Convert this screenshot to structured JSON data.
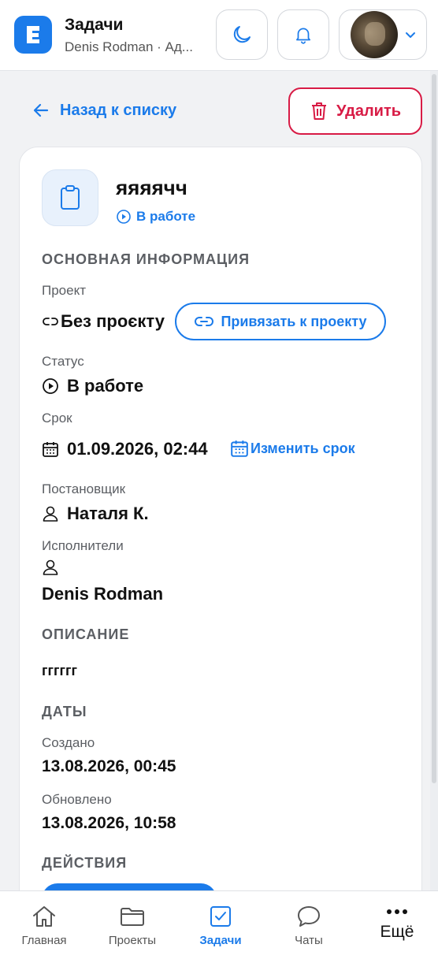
{
  "header": {
    "app_title": "Задачи",
    "app_subtitle": "Denis Rodman · Ад...",
    "logo_letter": "E"
  },
  "top_actions": {
    "back_label": "Назад к списку",
    "delete_label": "Удалить"
  },
  "task": {
    "title": "яяяячч",
    "status_badge": "В работе"
  },
  "sections": {
    "main_info": "ОСНОВНАЯ ИНФОРМАЦИЯ",
    "description": "ОПИСАНИЕ",
    "dates": "ДАТЫ",
    "actions": "ДЕЙСТВИЯ"
  },
  "fields": {
    "project_label": "Проект",
    "project_value": "Без проєкту",
    "link_project_label": "Привязать к проекту",
    "status_label": "Статус",
    "status_value": "В работе",
    "deadline_label": "Срок",
    "deadline_value": "01.09.2026, 02:44",
    "change_deadline_label": "Изменить срок",
    "creator_label": "Постановщик",
    "creator_value": "Наталя К.",
    "assignees_label": "Исполнители",
    "assignee_value": "Denis Rodman",
    "description_value": "гггггг",
    "created_label": "Создано",
    "created_value": "13.08.2026, 00:45",
    "updated_label": "Обновлено",
    "updated_value": "13.08.2026, 10:58"
  },
  "bottom_nav": {
    "items": [
      {
        "label": "Главная",
        "icon": "home-icon"
      },
      {
        "label": "Проекты",
        "icon": "folder-icon"
      },
      {
        "label": "Задачи",
        "icon": "checkbox-icon",
        "active": true
      },
      {
        "label": "Чаты",
        "icon": "chat-icon"
      },
      {
        "label": "Ещё",
        "icon": "more-icon"
      }
    ]
  },
  "colors": {
    "accent": "#1b7bea",
    "danger": "#d81b45"
  }
}
